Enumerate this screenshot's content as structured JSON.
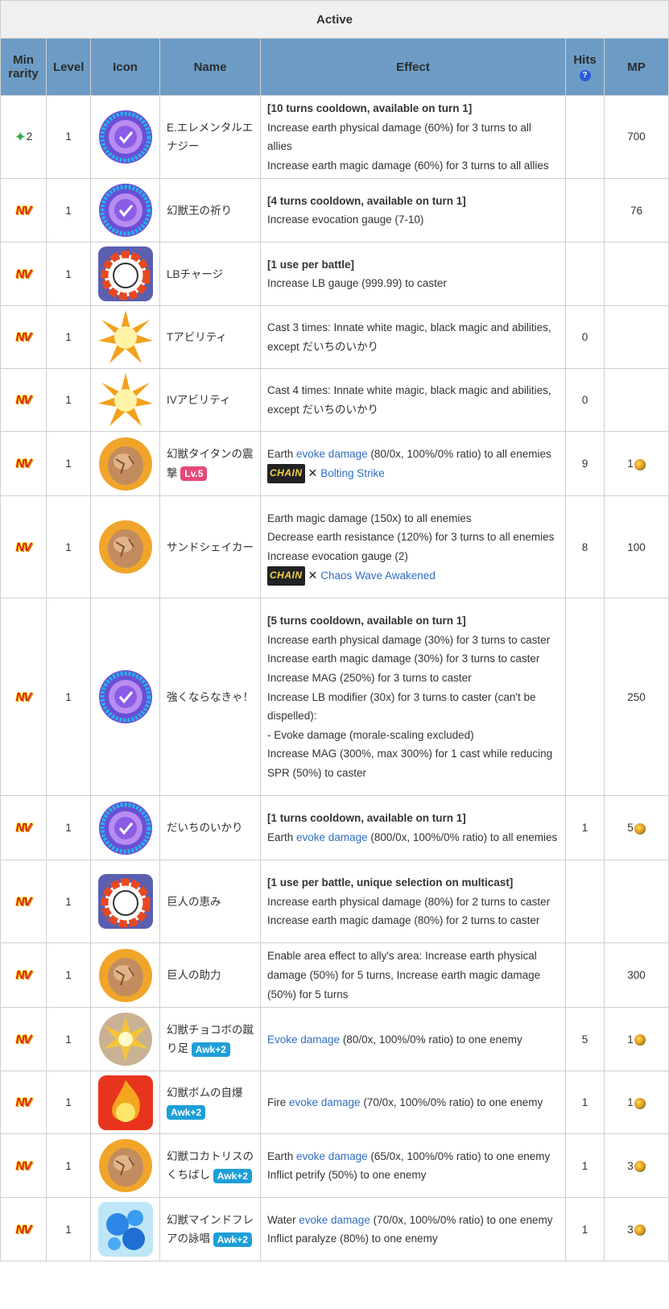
{
  "table_title": "Active",
  "columns": {
    "min_rarity": "Min rarity",
    "level": "Level",
    "icon": "Icon",
    "name": "Name",
    "effect": "Effect",
    "hits": "Hits",
    "mp": "MP"
  },
  "rows": [
    {
      "rarity": "2",
      "level": "1",
      "name": "E.エレメンタルエナジー",
      "lines": [
        "[10 turns cooldown, available on turn 1]",
        "Increase earth physical damage (60%) for 3 turns to all allies",
        "Increase earth magic damage (60%) for 3 turns to all allies"
      ],
      "hits": "",
      "mp": "700"
    },
    {
      "rarity": "NV",
      "level": "1",
      "name": "幻獣王の祈り",
      "lines": [
        "[4 turns cooldown, available on turn 1]",
        "Increase evocation gauge (7-10)"
      ],
      "hits": "",
      "mp": "76"
    },
    {
      "rarity": "NV",
      "level": "1",
      "name": "LBチャージ",
      "lines": [
        "[1 use per battle]",
        "Increase LB gauge (999.99) to caster"
      ],
      "hits": "",
      "mp": ""
    },
    {
      "rarity": "NV",
      "level": "1",
      "name": "Tアビリティ",
      "lines": [
        "Cast 3 times: Innate white magic, black magic and abilities, except だいちのいかり"
      ],
      "hits": "0",
      "mp": ""
    },
    {
      "rarity": "NV",
      "level": "1",
      "name": "IVアビリティ",
      "lines": [
        "Cast 4 times: Innate white magic, black magic and abilities, except だいちのいかり"
      ],
      "hits": "0",
      "mp": ""
    },
    {
      "rarity": "NV",
      "level": "1",
      "name": "幻獣タイタンの震撃",
      "badge": "Lv.5",
      "lines": [
        "Earth ",
        "evoke damage",
        " (80/0x, 100%/0% ratio) to all enemies"
      ],
      "chain": "Bolting Strike",
      "hits": "9",
      "mp": "1"
    },
    {
      "rarity": "NV",
      "level": "1",
      "name": "サンドシェイカー",
      "lines": [
        "Earth magic damage (150x) to all enemies",
        "Decrease earth resistance (120%) for 3 turns to all enemies",
        "Increase evocation gauge (2)"
      ],
      "chain": "Chaos Wave Awakened",
      "hits": "8",
      "mp": "100"
    },
    {
      "rarity": "NV",
      "level": "1",
      "name": "強くならなきゃ！",
      "lines": [
        "[5 turns cooldown, available on turn 1]",
        "Increase earth physical damage (30%) for 3 turns to caster",
        "Increase earth magic damage (30%) for 3 turns to caster",
        "Increase MAG (250%) for 3 turns to caster",
        "Increase LB modifier (30x) for 3 turns to caster (can't be dispelled):",
        "- Evoke damage (morale-scaling excluded)",
        "Increase MAG (300%, max 300%) for 1 cast while reducing SPR (50%) to caster"
      ],
      "hits": "",
      "mp": "250"
    },
    {
      "rarity": "NV",
      "level": "1",
      "name": "だいちのいかり",
      "lines": [
        "[1 turns cooldown, available on turn 1]",
        "Earth ",
        "evoke damage",
        " (800/0x, 100%/0% ratio) to all enemies"
      ],
      "hits": "1",
      "mp": "5"
    },
    {
      "rarity": "NV",
      "level": "1",
      "name": "巨人の恵み",
      "lines": [
        "[1 use per battle, unique selection on multicast]",
        "Increase earth physical damage (80%) for 2 turns to caster",
        "Increase earth magic damage (80%) for 2 turns to caster"
      ],
      "hits": "",
      "mp": ""
    },
    {
      "rarity": "NV",
      "level": "1",
      "name": "巨人の助力",
      "lines": [
        "Enable area effect to ally's area: Increase earth physical damage (50%) for 5 turns, Increase earth magic damage (50%) for 5 turns"
      ],
      "hits": "",
      "mp": "300"
    },
    {
      "rarity": "NV",
      "level": "1",
      "name": "幻獣チョコボの蹴り足",
      "badge": "Awk+2",
      "lines": [
        "Evoke damage",
        " (80/0x, 100%/0% ratio) to one enemy"
      ],
      "hits": "5",
      "mp": "1"
    },
    {
      "rarity": "NV",
      "level": "1",
      "name": "幻獣ボムの自爆",
      "badge": "Awk+2",
      "lines": [
        "Fire ",
        "evoke damage",
        " (70/0x, 100%/0% ratio) to one enemy"
      ],
      "hits": "1",
      "mp": "1"
    },
    {
      "rarity": "NV",
      "level": "1",
      "name": "幻獣コカトリスのくちばし",
      "badge": "Awk+2",
      "lines": [
        "Earth ",
        "evoke damage",
        " (65/0x, 100%/0% ratio) to one enemy",
        "Inflict petrify (50%) to one enemy"
      ],
      "hits": "1",
      "mp": "3"
    },
    {
      "rarity": "NV",
      "level": "1",
      "name": "幻獣マインドフレアの詠唱",
      "badge": "Awk+2",
      "lines": [
        "Water ",
        "evoke damage",
        " (70/0x, 100%/0% ratio) to one enemy",
        "Inflict paralyze (80%) to one enemy"
      ],
      "hits": "1",
      "mp": "3"
    }
  ],
  "icons": {
    "r1": "vortex-icon",
    "r2": "vortex-icon",
    "r3": "lb-gauge-icon",
    "r4": "starburst-icon",
    "r5": "starburst-icon",
    "r6": "rock-icon",
    "r7": "rock-icon",
    "r8": "vortex-icon",
    "r9": "vortex-icon",
    "r10": "lb-gauge-icon",
    "r11": "rock-icon",
    "r12": "explosion-icon",
    "r13": "fire-icon",
    "r14": "rock-icon",
    "r15": "bubbles-icon"
  },
  "colors": {
    "header_bg": "#6c9cc6",
    "title_bg": "#f0f0f0",
    "link": "#2f6fc2",
    "lv_badge": "#e84878",
    "awk_badge": "#1e9fd8"
  }
}
